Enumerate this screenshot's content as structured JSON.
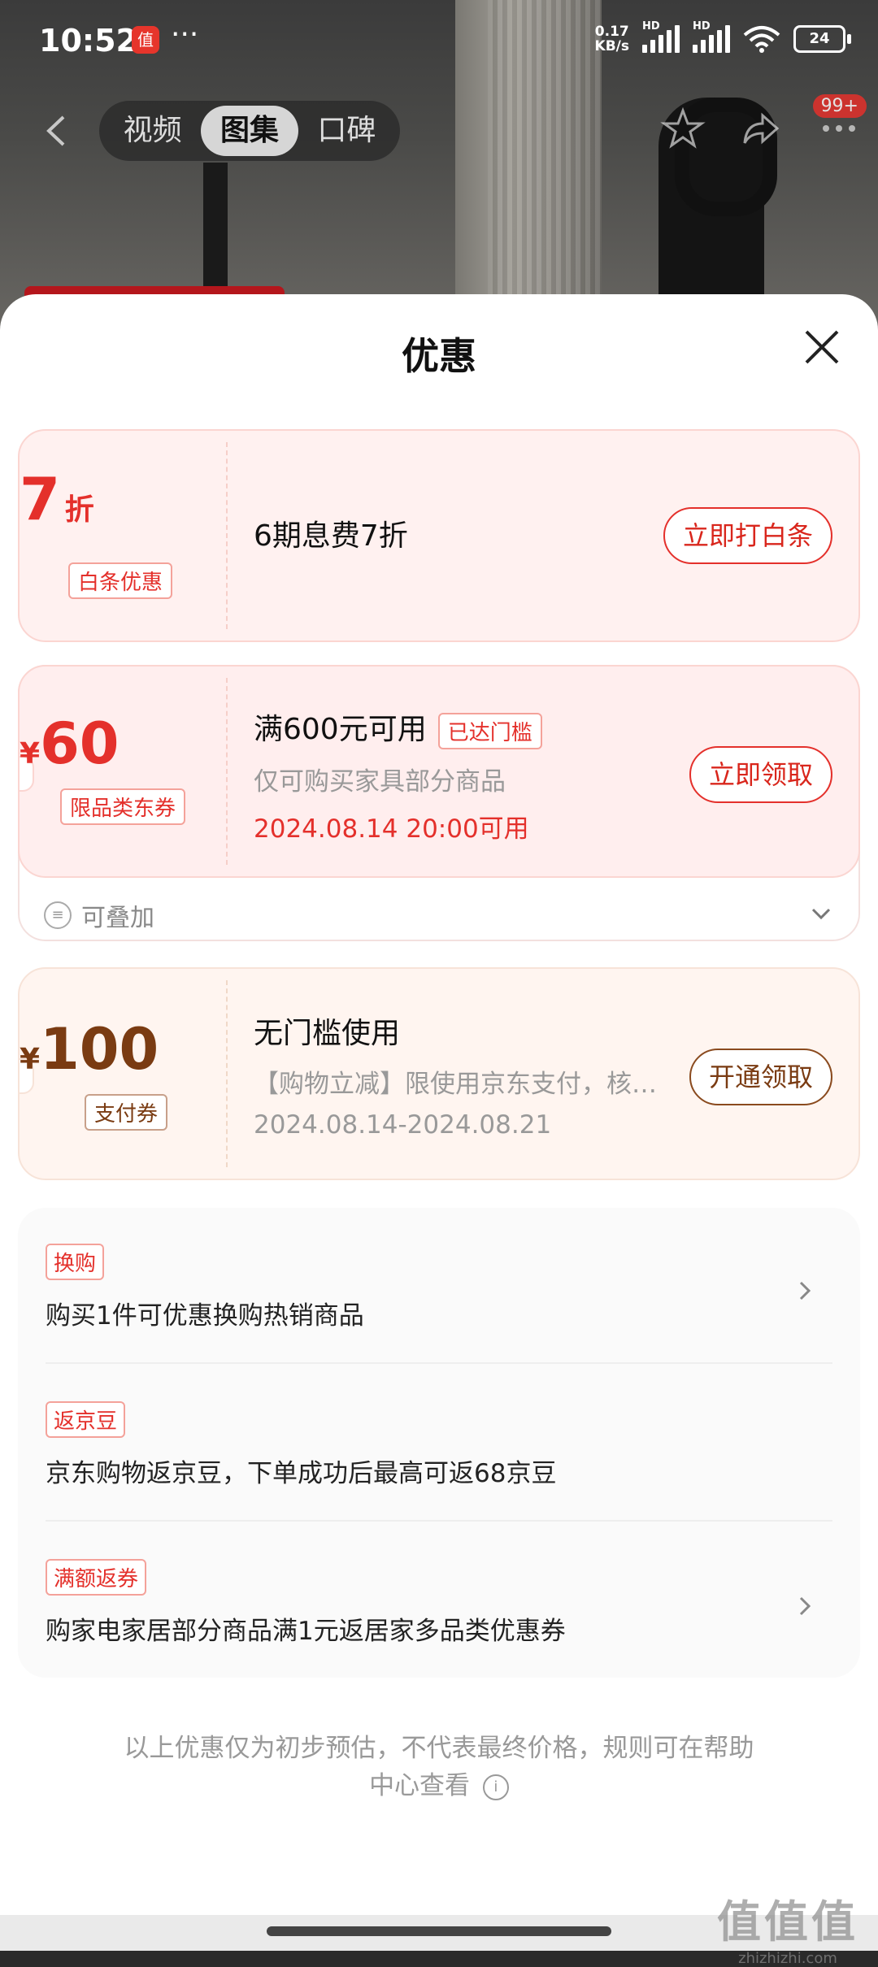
{
  "status_bar": {
    "time": "10:52",
    "app_icon_text": "值",
    "more": "···",
    "net_speed_value": "0.17",
    "net_speed_unit": "KB/s",
    "signal_label": "HD",
    "battery": "24"
  },
  "top_nav": {
    "tabs": [
      "视频",
      "图集",
      "口碑"
    ],
    "active_tab": "图集",
    "badge": "99+"
  },
  "sheet": {
    "title": "优惠",
    "coupons": [
      {
        "value": "7",
        "unit": "折",
        "tag": "白条优惠",
        "title": "6期息费7折",
        "button": "立即打白条"
      },
      {
        "currency": "¥",
        "value": "60",
        "tag": "限品类东券",
        "title": "满600元可用",
        "status_tag": "已达门槛",
        "desc": "仅可购买家具部分商品",
        "time": "2024.08.14 20:00可用",
        "button": "立即领取",
        "stack_label": "可叠加"
      },
      {
        "currency": "¥",
        "value": "100",
        "tag": "支付券",
        "title": "无门槛使用",
        "desc": "【购物立减】限使用京东支付，核…",
        "time": "2024.08.14-2024.08.21",
        "button": "开通领取"
      }
    ],
    "promotions": [
      {
        "tag": "换购",
        "text": "购买1件可优惠换购热销商品"
      },
      {
        "tag": "返京豆",
        "text": "京东购物返京豆，下单成功后最高可返68京豆"
      },
      {
        "tag": "满额返券",
        "text": "购家电家居部分商品满1元返居家多品类优惠券"
      }
    ],
    "footnote_line1": "以上优惠仅为初步预估，不代表最终价格，规则可在帮助",
    "footnote_line2": "中心查看"
  },
  "watermark": {
    "logo": "值值值",
    "site": "zhizhizhi.com"
  },
  "colors": {
    "accent_red": "#e4302b",
    "brown": "#7a3b12"
  }
}
